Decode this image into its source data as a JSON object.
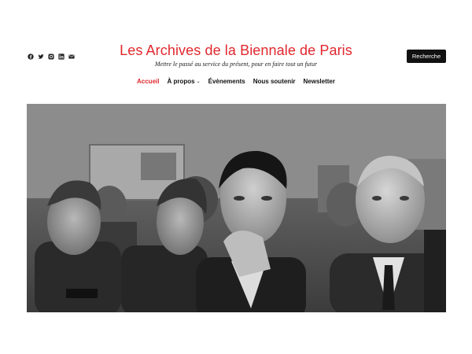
{
  "header": {
    "site_title": "Les Archives de la Biennale de Paris",
    "tagline": "Mettre le passé au service du présent, pour en faire tout un futur",
    "search_label": "Recherche"
  },
  "social": [
    "facebook-icon",
    "twitter-icon",
    "instagram-icon",
    "linkedin-icon",
    "email-icon"
  ],
  "nav": {
    "items": [
      {
        "label": "Accueil",
        "active": true
      },
      {
        "label": "À propos",
        "has_submenu": true
      },
      {
        "label": "Évènements"
      },
      {
        "label": "Nous soutenir"
      },
      {
        "label": "Newsletter"
      }
    ]
  },
  "colors": {
    "accent": "#e0282e",
    "button_bg": "#111111"
  },
  "hero": {
    "image": "black-and-white photograph of men at an exhibition"
  }
}
